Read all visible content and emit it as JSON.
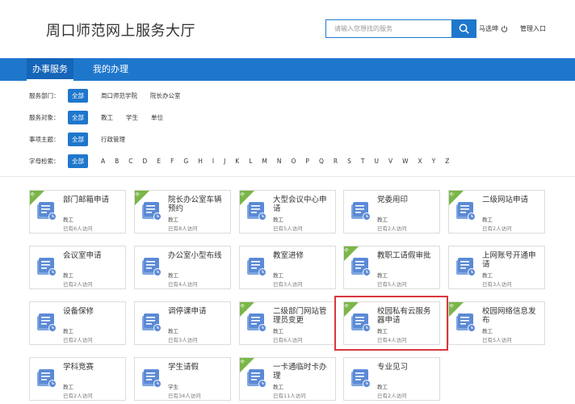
{
  "header": {
    "title": "周口师范网上服务大厅",
    "search_placeholder": "请输入您想找的服务",
    "user_name": "马选坤",
    "admin_label": "管理入口"
  },
  "nav": {
    "tabs": [
      {
        "label": "办事服务",
        "active": true
      },
      {
        "label": "我的办理",
        "active": false
      }
    ]
  },
  "filters": {
    "department": {
      "label": "服务部门：",
      "all": "全部",
      "options": [
        "周口师范学院",
        "院长办公室"
      ]
    },
    "audience": {
      "label": "服务对象：",
      "all": "全部",
      "options": [
        "教工",
        "学生",
        "单位"
      ]
    },
    "topic": {
      "label": "事项主题：",
      "all": "全部",
      "options": [
        "行政管理"
      ]
    },
    "letters": {
      "label": "字母检索：",
      "all": "全部",
      "options": [
        "A",
        "B",
        "C",
        "D",
        "E",
        "F",
        "G",
        "H",
        "I",
        "J",
        "K",
        "L",
        "M",
        "N",
        "O",
        "P",
        "Q",
        "R",
        "S",
        "T",
        "U",
        "V",
        "W",
        "X",
        "Y",
        "Z"
      ]
    }
  },
  "hot_label": "热",
  "cards": [
    {
      "name": "部门邮箱申请",
      "target": "教工",
      "visits": "已有6人访问",
      "hot": true
    },
    {
      "name": "院长办公室车辆预约",
      "target": "教工",
      "visits": "已有8人访问",
      "hot": true
    },
    {
      "name": "大型会议中心申请",
      "target": "教工",
      "visits": "已有5人访问",
      "hot": true
    },
    {
      "name": "党委用印",
      "target": "教工",
      "visits": "已有2人访问",
      "hot": false
    },
    {
      "name": "二级网站申请",
      "target": "教工",
      "visits": "已有2人访问",
      "hot": true
    },
    {
      "name": "会议室申请",
      "target": "教工",
      "visits": "已有2人访问",
      "hot": false
    },
    {
      "name": "办公室小型布线",
      "target": "教工",
      "visits": "已有4人访问",
      "hot": false
    },
    {
      "name": "教室进修",
      "target": "教工",
      "visits": "已有3人访问",
      "hot": false
    },
    {
      "name": "教职工请假审批",
      "target": "教工",
      "visits": "已有5人访问",
      "hot": true
    },
    {
      "name": "上网账号开通申请",
      "target": "教工",
      "visits": "已有3人访问",
      "hot": false
    },
    {
      "name": "设备保修",
      "target": "教工",
      "visits": "已有2人访问",
      "hot": false
    },
    {
      "name": "调停课申请",
      "target": "教工",
      "visits": "已有3人访问",
      "hot": false
    },
    {
      "name": "二级部门网站管理员变更",
      "target": "教工",
      "visits": "已有6人访问",
      "hot": true
    },
    {
      "name": "校园私有云服务器申请",
      "target": "教工",
      "visits": "已有4人访问",
      "hot": true
    },
    {
      "name": "校园网络信息发布",
      "target": "教工",
      "visits": "已有5人访问",
      "hot": true
    },
    {
      "name": "学科竞赛",
      "target": "教工",
      "visits": "已有2人访问",
      "hot": false
    },
    {
      "name": "学生请假",
      "target": "学生",
      "visits": "已有34人访问",
      "hot": false
    },
    {
      "name": "一卡通临时卡办理",
      "target": "教工",
      "visits": "已有11人访问",
      "hot": true
    },
    {
      "name": "专业见习",
      "target": "教工",
      "visits": "已有2人访问",
      "hot": false
    }
  ],
  "colors": {
    "primary": "#1f77cc",
    "hot": "#7ab648",
    "highlight": "#d9363e"
  }
}
